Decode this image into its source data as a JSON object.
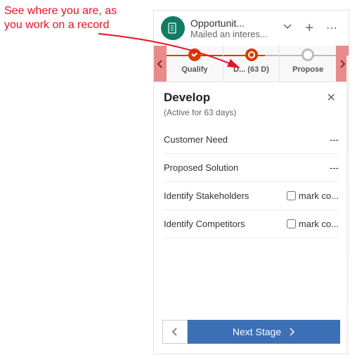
{
  "annotation": {
    "line1": "See where you are, as",
    "line2": "you work on a record"
  },
  "header": {
    "title": "Opportunit...",
    "subtitle": "Mailed an interes..."
  },
  "stages": {
    "items": [
      {
        "label": "Qualify",
        "state": "done"
      },
      {
        "label": "D...  (63 D)",
        "state": "current"
      },
      {
        "label": "Propose",
        "state": "future"
      }
    ]
  },
  "panel": {
    "title": "Develop",
    "subtitle": "(Active for 63 days)",
    "fields": [
      {
        "label": "Customer Need",
        "value": "---",
        "type": "text"
      },
      {
        "label": "Proposed Solution",
        "value": "---",
        "type": "text"
      },
      {
        "label": "Identify Stakeholders",
        "checkLabel": "mark co...",
        "type": "check"
      },
      {
        "label": "Identify Competitors",
        "checkLabel": "mark co...",
        "type": "check"
      }
    ],
    "nextLabel": "Next Stage"
  }
}
